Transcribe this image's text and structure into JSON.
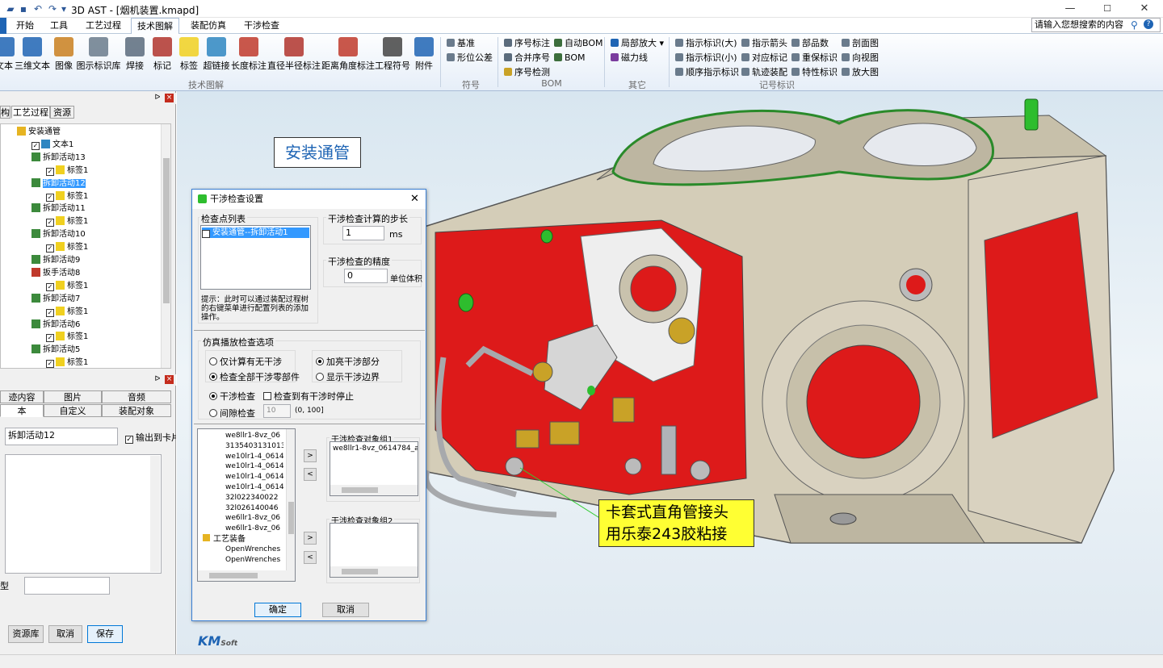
{
  "window": {
    "app_title": "3D AST - [烟机装置.kmapd]",
    "min_icon": "minimize-icon",
    "max_icon": "maximize-icon",
    "close_icon": "close-icon"
  },
  "quick_access": [
    "open-icon",
    "save-icon",
    "undo-icon",
    "redo-icon",
    "customize-icon"
  ],
  "menu_tabs": [
    "开始",
    "工具",
    "工艺过程",
    "技术图解",
    "装配仿真",
    "干涉检查"
  ],
  "active_tab": "技术图解",
  "search": {
    "placeholder": "请输入您想搜索的内容"
  },
  "ribbon": {
    "big_buttons": [
      {
        "label": "文本",
        "icon": "text-icon"
      },
      {
        "label": "三维文本",
        "icon": "3d-text-icon"
      },
      {
        "label": "图像",
        "icon": "image-icon"
      },
      {
        "label": "图示标识库",
        "icon": "symbol-library-icon"
      },
      {
        "label": "焊接",
        "icon": "weld-icon"
      },
      {
        "label": "标记",
        "icon": "mark-icon"
      },
      {
        "label": "标签",
        "icon": "label-icon"
      },
      {
        "label": "超链接",
        "icon": "hyperlink-icon"
      },
      {
        "label": "长度标注",
        "icon": "length-dimension-icon"
      },
      {
        "label": "直径半径标注",
        "icon": "diameter-radius-icon"
      },
      {
        "label": "距离角度标注",
        "icon": "distance-angle-icon"
      },
      {
        "label": "工程符号",
        "icon": "engineering-symbol-icon"
      },
      {
        "label": "附件",
        "icon": "attachment-icon"
      }
    ],
    "group_tech": "技术图解",
    "symbol_items": [
      "基准",
      "形位公差"
    ],
    "group_symbol": "符号",
    "bom_items": [
      "序号标注",
      "自动BOM",
      "合并序号",
      "BOM",
      "序号检测"
    ],
    "group_bom": "BOM",
    "other_items": [
      "局部放大",
      "磁力线"
    ],
    "group_other": "其它",
    "mark_items": [
      "指示标识(大)",
      "指示箭头",
      "部品数",
      "剖面图",
      "指示标识(小)",
      "对应标记",
      "重保标识",
      "向视图",
      "顺序指示标识",
      "轨迹装配",
      "特性标识",
      "放大图"
    ],
    "group_mark": "记号标识"
  },
  "left_panel": {
    "tabs": [
      "构",
      "工艺过程",
      "资源"
    ],
    "tree": [
      {
        "label": "安装通管",
        "level": 0,
        "kind": "folder"
      },
      {
        "label": "文本1",
        "level": 1,
        "kind": "text",
        "checked": true
      },
      {
        "label": "拆卸活动13",
        "level": 1,
        "kind": "activity"
      },
      {
        "label": "标签1",
        "level": 2,
        "kind": "label",
        "checked": true
      },
      {
        "label": "拆卸活动12",
        "level": 1,
        "kind": "activity",
        "selected": true
      },
      {
        "label": "标签1",
        "level": 2,
        "kind": "label",
        "checked": true
      },
      {
        "label": "拆卸活动11",
        "level": 1,
        "kind": "activity"
      },
      {
        "label": "标签1",
        "level": 2,
        "kind": "label",
        "checked": true
      },
      {
        "label": "拆卸活动10",
        "level": 1,
        "kind": "activity"
      },
      {
        "label": "标签1",
        "level": 2,
        "kind": "label",
        "checked": true
      },
      {
        "label": "拆卸活动9",
        "level": 1,
        "kind": "activity"
      },
      {
        "label": "扳手活动8",
        "level": 1,
        "kind": "wrench"
      },
      {
        "label": "标签1",
        "level": 2,
        "kind": "label",
        "checked": true
      },
      {
        "label": "拆卸活动7",
        "level": 1,
        "kind": "activity"
      },
      {
        "label": "标签1",
        "level": 2,
        "kind": "label",
        "checked": true
      },
      {
        "label": "拆卸活动6",
        "level": 1,
        "kind": "activity"
      },
      {
        "label": "标签1",
        "level": 2,
        "kind": "label",
        "checked": true
      },
      {
        "label": "拆卸活动5",
        "level": 1,
        "kind": "activity"
      },
      {
        "label": "标签1",
        "level": 2,
        "kind": "label",
        "checked": true
      }
    ],
    "prop_tabs_row1": [
      "迹内容",
      "图片",
      "音频"
    ],
    "prop_tabs_row2": [
      "本",
      "自定义",
      "装配对象"
    ],
    "name_value": "拆卸活动12",
    "output_to_card": "输出到卡片",
    "type_label": "型",
    "buttons": [
      "资源库",
      "取消",
      "保存"
    ]
  },
  "viewport": {
    "title_note": "安装通管",
    "callout_line1": "卡套式直角管接头",
    "callout_line2": "用乐泰243胶粘接",
    "logo_text": "KM",
    "logo_sub": "Soft"
  },
  "dialog": {
    "title": "干涉检查设置",
    "close_icon": "close-icon",
    "checkpoint_list_label": "检查点列表",
    "checkpoint_item": "安装通管--拆卸活动1",
    "hint": "提示：此时可以通过装配过程树的右键菜单进行配置列表的添加操作。",
    "step_label": "干涉检查计算的步长",
    "step_value": "1",
    "step_unit": "ms",
    "precision_label": "干涉检查的精度",
    "precision_value": "0",
    "precision_unit": "单位体积",
    "sim_group": "仿真播放检查选项",
    "opt_only_whether": "仅计算有无干涉",
    "opt_highlight": "加亮干涉部分",
    "opt_check_all": "检查全部干涉零部件",
    "opt_show_boundary": "显示干涉边界",
    "opt_interference": "干涉检查",
    "opt_stop": "检查到有干涉时停止",
    "opt_clearance": "间隙检查",
    "clearance_value": "10",
    "clearance_range": "(0, 100]",
    "parts": [
      "we8llr1-8vz_06",
      "3135403131013",
      "we10lr1-4_0614",
      "we10lr1-4_0614",
      "we10lr1-4_0614",
      "we10lr1-4_0614",
      "32l022340022",
      "32l026140046",
      "we6llr1-8vz_06",
      "we6llr1-8vz_06"
    ],
    "tool_group": "工艺装备",
    "tool_items": [
      "OpenWrenches",
      "OpenWrenches"
    ],
    "group1_label": "干涉检查对象组1",
    "group1_items": [
      "we8llr1-8vz_0614784_a"
    ],
    "group2_label": "干涉检查对象组2",
    "group2_items": [],
    "ok": "确定",
    "cancel": "取消"
  },
  "colors": {
    "accent": "#1e64b4",
    "selection": "#3399ff",
    "part_red": "#dd1a1a",
    "part_body": "#d9d2c0",
    "callout_bg": "#ffff33"
  }
}
